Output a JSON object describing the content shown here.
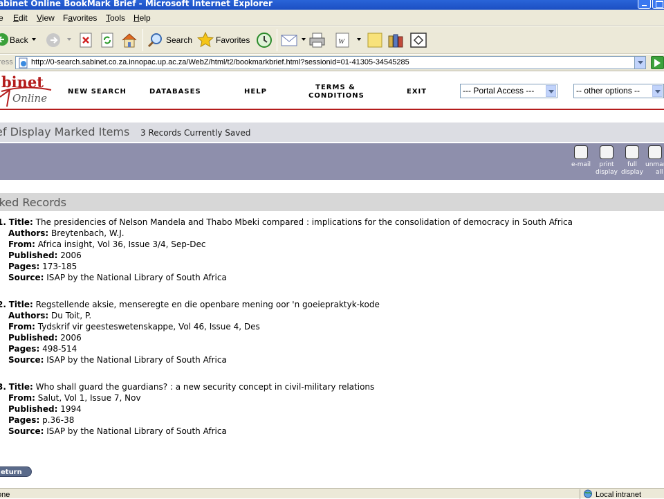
{
  "window": {
    "title": "abinet Online BookMark Brief - Microsoft Internet Explorer"
  },
  "menubar": {
    "items": [
      {
        "pre": "",
        "acc": "",
        "post": "e"
      },
      {
        "pre": "",
        "acc": "E",
        "post": "dit"
      },
      {
        "pre": "",
        "acc": "V",
        "post": "iew"
      },
      {
        "pre": "F",
        "acc": "a",
        "post": "vorites"
      },
      {
        "pre": "",
        "acc": "T",
        "post": "ools"
      },
      {
        "pre": "",
        "acc": "H",
        "post": "elp"
      }
    ]
  },
  "toolbar": {
    "back_label": "Back",
    "search_label": "Search",
    "favorites_label": "Favorites"
  },
  "address": {
    "label": "ress",
    "url": "http://0-search.sabinet.co.za.innopac.up.ac.za/WebZ/html/t2/bookmarkbrief.html?sessionid=01-41305-34545285"
  },
  "header": {
    "logo_top": "binet",
    "logo_bottom": "Online",
    "nav": {
      "new_search": "NEW SEARCH",
      "databases": "DATABASES",
      "help": "HELP",
      "terms_line1": "TERMS &",
      "terms_line2": "CONDITIONS",
      "exit": "EXIT"
    },
    "portal_select": "--- Portal Access ---",
    "options_select": "-- other options --"
  },
  "page": {
    "title": "ef Display Marked Items",
    "records_saved": "3 Records Currently Saved",
    "section_title": "rked Records",
    "return_label": "eturn"
  },
  "actions": {
    "email": [
      "e-mail"
    ],
    "print": [
      "print",
      "display"
    ],
    "full": [
      "full",
      "display"
    ],
    "unmark": [
      "unmar",
      "all"
    ]
  },
  "labels": {
    "title": "Title:",
    "authors": "Authors:",
    "from": "From:",
    "published": "Published:",
    "pages": "Pages:",
    "source": "Source:"
  },
  "records": [
    {
      "num": "1.",
      "title": "The presidencies of Nelson Mandela and Thabo Mbeki compared : implications for the consolidation of democracy in South Africa",
      "authors": "Breytenbach, W.J.",
      "from": "Africa insight, Vol 36, Issue 3/4, Sep-Dec",
      "published": "2006",
      "pages": "173-185",
      "source": "ISAP by the National Library of South Africa"
    },
    {
      "num": "2.",
      "title": "Regstellende aksie, menseregte en die openbare mening oor 'n goeiepraktyk-kode",
      "authors": "Du Toit, P.",
      "from": "Tydskrif vir geesteswetenskappe, Vol 46, Issue 4, Des",
      "published": "2006",
      "pages": "498-514",
      "source": "ISAP by the National Library of South Africa"
    },
    {
      "num": "3.",
      "title": "Who shall guard the guardians? : a new security concept in civil-military relations",
      "from": "Salut, Vol 1, Issue 7, Nov",
      "published": "1994",
      "pages": "p.36-38",
      "source": "ISAP by the National Library of South Africa"
    }
  ],
  "status": {
    "left": "one",
    "right": "Local intranet"
  },
  "colors": {
    "titlebar": "#1c4fc3",
    "chrome": "#ece9d8",
    "action_band": "#8e8fac",
    "title_band": "#dcdde3",
    "brand_red": "#b41c1c"
  }
}
